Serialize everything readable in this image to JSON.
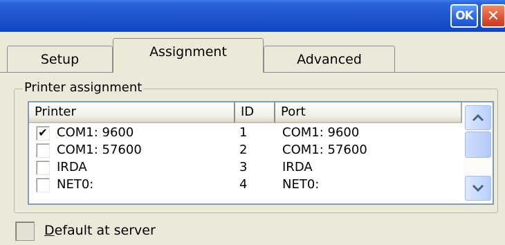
{
  "titlebar": {
    "ok_label": "OK",
    "close_label": "✕",
    "color": "#1e56d0"
  },
  "tabs": [
    {
      "label": "Setup",
      "active": false
    },
    {
      "label": "Assignment",
      "active": true
    },
    {
      "label": "Advanced",
      "active": false
    }
  ],
  "group": {
    "label": "Printer assignment"
  },
  "list": {
    "columns": [
      "Printer",
      "ID",
      "Port"
    ],
    "rows": [
      {
        "checked": true,
        "printer": "COM1: 9600",
        "id": "1",
        "port": "COM1: 9600"
      },
      {
        "checked": false,
        "printer": "COM1: 57600",
        "id": "2",
        "port": "COM1: 57600"
      },
      {
        "checked": false,
        "printer": "IRDA",
        "id": "3",
        "port": "IRDA"
      },
      {
        "checked": false,
        "printer": "NET0:",
        "id": "4",
        "port": "NET0:"
      }
    ],
    "scroll_up_icon": "chevron-up-icon",
    "scroll_down_icon": "chevron-down-icon",
    "check_mark": "✔"
  },
  "default_at_server": {
    "label_first": "D",
    "label_rest": "efault at server",
    "checked": false
  }
}
